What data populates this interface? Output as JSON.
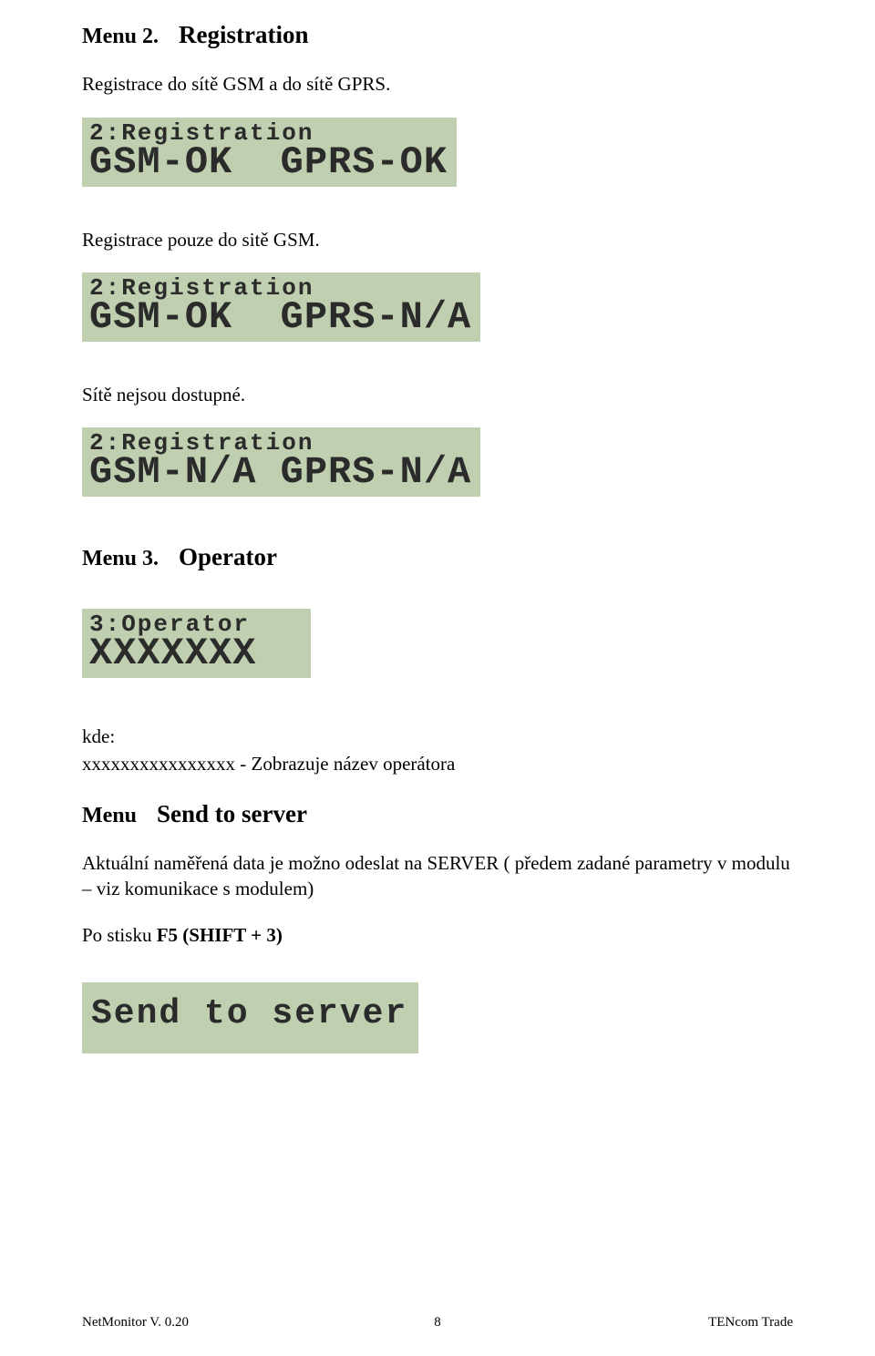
{
  "sections": {
    "menu2": {
      "menu_label": "Menu 2.",
      "title": "Registration",
      "intro": "Registrace do sítě GSM a do sítě GPRS.",
      "lcd1_row1": "2:Registration",
      "lcd1_row2": "GSM-OK  GPRS-OK",
      "text_gsm_only": "Registrace pouze do sitě GSM.",
      "lcd2_row1": "2:Registration",
      "lcd2_row2": "GSM-OK  GPRS-N/A",
      "text_no_net": "Sítě nejsou dostupné.",
      "lcd3_row1": "2:Registration",
      "lcd3_row2": "GSM-N/A GPRS-N/A"
    },
    "menu3": {
      "menu_label": "Menu 3.",
      "title": "Operator",
      "lcd_row1": "3:Operator",
      "lcd_row2": "XXXXXXX",
      "kde_label": "kde:",
      "kde_desc": "xxxxxxxxxxxxxxxx - Zobrazuje název operátora"
    },
    "send": {
      "heading_prefix": "Menu",
      "heading_title": "Send to server",
      "desc": "Aktuální naměřená data je možno odeslat na SERVER ( předem zadané parametry v modulu – viz komunikace s modulem)",
      "press": "Po stisku ",
      "press_key": "F5 (SHIFT + 3)",
      "lcd_row1": "Send to server"
    }
  },
  "footer": {
    "left": "NetMonitor V. 0.20",
    "center": "8",
    "right": "TENcom Trade"
  }
}
